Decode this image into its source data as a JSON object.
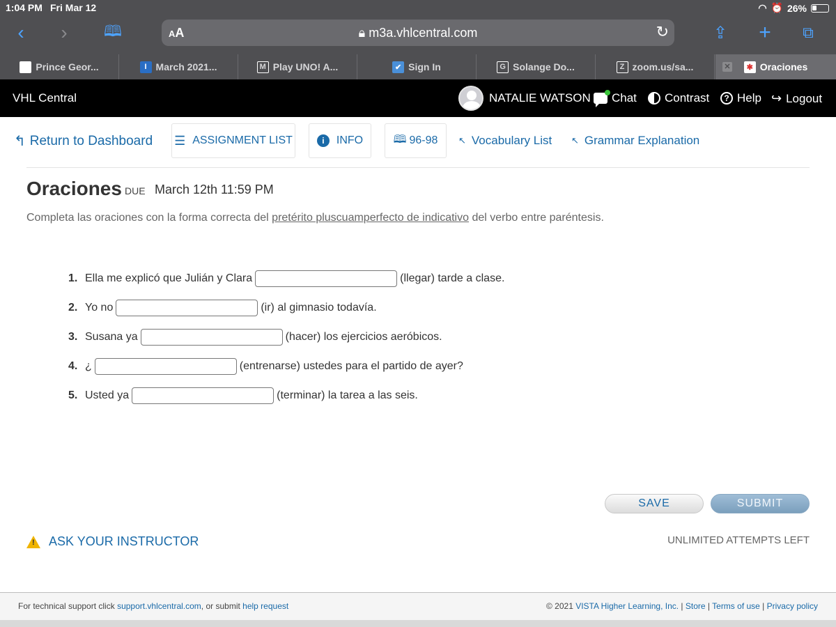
{
  "status_bar": {
    "time": "1:04 PM",
    "date": "Fri Mar 12",
    "battery": "26%"
  },
  "browser": {
    "aa_label_small": "A",
    "aa_label_large": "A",
    "url": "m3a.vhlcentral.com",
    "tabs": [
      {
        "label": "Prince Geor...",
        "icon": "blank-page-icon"
      },
      {
        "label": "March 2021...",
        "icon": "document-icon"
      },
      {
        "label": "Play UNO! A...",
        "icon": "m-icon"
      },
      {
        "label": "Sign In",
        "icon": "check-icon"
      },
      {
        "label": "Solange Do...",
        "icon": "g-icon"
      },
      {
        "label": "zoom.us/sa...",
        "icon": "z-icon"
      },
      {
        "label": "Oraciones",
        "icon": "vhl-icon"
      }
    ]
  },
  "header": {
    "brand": "VHL Central",
    "user": "NATALIE WATSON",
    "chat": "Chat",
    "contrast": "Contrast",
    "help": "Help",
    "logout": "Logout"
  },
  "subnav": {
    "return": "Return to Dashboard",
    "assignment_list": "ASSIGNMENT LIST",
    "info": "INFO",
    "pages": "96-98",
    "vocab": "Vocabulary List",
    "grammar": "Grammar Explanation"
  },
  "activity": {
    "title": "Oraciones",
    "due_label": "DUE",
    "due_date": "March 12th 11:59 PM",
    "instructions_pre": "Completa las oraciones con la forma correcta del ",
    "instructions_link": "pretérito pluscuamperfecto de indicativo",
    "instructions_post": " del verbo entre paréntesis.",
    "questions": [
      {
        "num": "1.",
        "before": "Ella me explicó que Julián y Clara",
        "value": "",
        "after": "(llegar) tarde a clase."
      },
      {
        "num": "2.",
        "before": "Yo no",
        "value": "",
        "after": "(ir) al gimnasio todavía."
      },
      {
        "num": "3.",
        "before": "Susana ya",
        "value": "",
        "after": "(hacer) los ejercicios aeróbicos."
      },
      {
        "num": "4.",
        "before": "¿",
        "value": "",
        "after": "(entrenarse) ustedes para el partido de ayer?"
      },
      {
        "num": "5.",
        "before": "Usted ya",
        "value": "",
        "after": "(terminar) la tarea a las seis."
      }
    ],
    "save": "SAVE",
    "submit": "SUBMIT",
    "ask": "ASK YOUR INSTRUCTOR",
    "attempts": "UNLIMITED ATTEMPTS LEFT"
  },
  "footer": {
    "support_pre": "For technical support click ",
    "support_link": "support.vhlcentral.com",
    "support_mid": ", or submit ",
    "help_request": "help request",
    "copyright": "© 2021 ",
    "company": "VISTA Higher Learning, Inc.",
    "store": "Store",
    "terms": "Terms of use",
    "privacy": "Privacy policy"
  }
}
